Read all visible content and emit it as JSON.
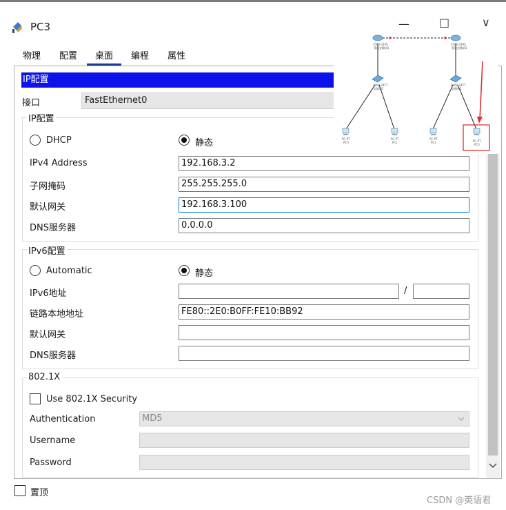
{
  "window": {
    "title": "PC3",
    "minimize": "—",
    "maximize": "□",
    "close": "∨"
  },
  "tabs": [
    {
      "label": "物理"
    },
    {
      "label": "配置"
    },
    {
      "label": "桌面"
    },
    {
      "label": "编程"
    },
    {
      "label": "属性"
    }
  ],
  "active_tab": "桌面",
  "header": "IP配置",
  "interface": {
    "label": "接口",
    "value": "FastEthernet0"
  },
  "ipv4": {
    "group_title": "IP配置",
    "dhcp_label": "DHCP",
    "static_label": "静态",
    "mode": "static",
    "address_label": "IPv4 Address",
    "address": "192.168.3.2",
    "mask_label": "子网掩码",
    "mask": "255.255.255.0",
    "gateway_label": "默认网关",
    "gateway": "192.168.3.100",
    "dns_label": "DNS服务器",
    "dns": "0.0.0.0"
  },
  "ipv6": {
    "group_title": "IPv6配置",
    "auto_label": "Automatic",
    "static_label": "静态",
    "mode": "static",
    "address_label": "IPv6地址",
    "address": "",
    "slash": "/",
    "prefix": "",
    "link_local_label": "链路本地地址",
    "link_local": "FE80::2E0:B0FF:FE10:BB92",
    "gateway_label": "默认网关",
    "gateway": "",
    "dns_label": "DNS服务器",
    "dns": ""
  },
  "dot1x": {
    "group_title": "802.1X",
    "use_label": "Use 802.1X Security",
    "checked": false,
    "auth_label": "Authentication",
    "auth_value": "MD5",
    "username_label": "Username",
    "username": "",
    "password_label": "Password",
    "password": ""
  },
  "always_on_top": {
    "label": "置顶",
    "checked": false
  },
  "topology": {
    "switch_labels": [
      "3560-24PS",
      "3560-24PS"
    ],
    "switch_names": [
      "多层交换机1",
      "多层交换机2"
    ],
    "router_labels": [
      "2960-24TT",
      "2960-24TT"
    ],
    "router_names": [
      "交换机1",
      "交换机2"
    ],
    "pc_labels": [
      "PC-PT",
      "PC-PT",
      "PC-PT",
      "PC-PT"
    ],
    "pc_names": [
      "PC0",
      "PC1",
      "PC2",
      "PC3"
    ]
  },
  "watermark": "CSDN @英语君",
  "colors": {
    "header_bg": "#0c12e9",
    "tab_underline": "#1a3d8c",
    "focus": "#0078d7",
    "highlight": "#e03030"
  }
}
